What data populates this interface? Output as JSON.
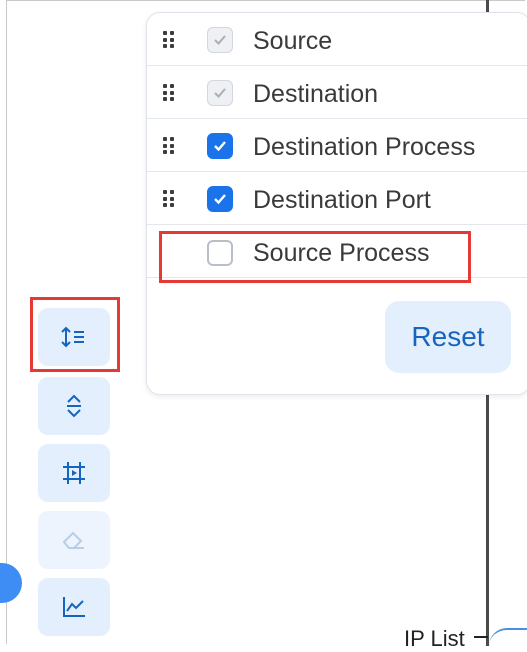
{
  "columns_menu": {
    "items": [
      {
        "label": "Source",
        "checked": true,
        "disabled": true,
        "draggable": true
      },
      {
        "label": "Destination",
        "checked": true,
        "disabled": true,
        "draggable": true
      },
      {
        "label": "Destination Process",
        "checked": true,
        "disabled": false,
        "draggable": true
      },
      {
        "label": "Destination Port",
        "checked": true,
        "disabled": false,
        "draggable": true
      },
      {
        "label": "Source Process",
        "checked": false,
        "disabled": false,
        "draggable": false
      }
    ],
    "reset_label": "Reset"
  },
  "toolbar": {
    "tools": [
      {
        "icon": "sort-columns-icon"
      },
      {
        "icon": "expand-collapse-icon"
      },
      {
        "icon": "fit-frame-icon"
      },
      {
        "icon": "eraser-icon",
        "disabled": true
      },
      {
        "icon": "line-chart-icon"
      }
    ]
  },
  "canvas": {
    "node_label": "IP List"
  },
  "colors": {
    "accent": "#1a73e8",
    "button_bg": "#e3effd",
    "highlight": "#e53935",
    "text": "#3a3a3a"
  }
}
